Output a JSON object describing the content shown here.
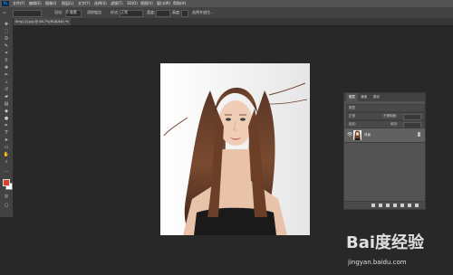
{
  "app": {
    "logo": "Ps",
    "menus": [
      "文件(F)",
      "编辑(E)",
      "图像(I)",
      "图层(L)",
      "文字(Y)",
      "选择(S)",
      "滤镜(T)",
      "3D(D)",
      "视图(V)",
      "窗口(W)",
      "帮助(H)"
    ]
  },
  "options": {
    "feather_label": "羽化:",
    "feather_value": "0 像素",
    "antialias_label": "消除锯齿",
    "style_label": "样式:",
    "style_value": "正常",
    "width_label": "宽度:",
    "height_label": "高度:",
    "refine_label": "选择并遮住..."
  },
  "document": {
    "tab_label": "timg (2).jpg @ 66.7%(RGB/8#) *",
    "close_glyph": "×"
  },
  "tools": [
    "move-tool",
    "marquee-tool",
    "lasso-tool",
    "quick-select-tool",
    "crop-tool",
    "eyedropper-tool",
    "healing-tool",
    "brush-tool",
    "stamp-tool",
    "history-brush-tool",
    "eraser-tool",
    "gradient-tool",
    "blur-tool",
    "dodge-tool",
    "pen-tool",
    "type-tool",
    "path-select-tool",
    "shape-tool",
    "hand-tool",
    "zoom-tool"
  ],
  "colors": {
    "foreground": "#d9402b",
    "background": "#ffffff"
  },
  "layers_panel": {
    "tabs": [
      "图层",
      "通道",
      "路径"
    ],
    "kind_label": "类型",
    "blend_mode": "正常",
    "opacity_label": "不透明度:",
    "lock_label": "锁定:",
    "fill_label": "填充:",
    "layers": [
      {
        "name": "背景",
        "visible": true,
        "locked": true
      }
    ]
  },
  "watermark": {
    "logo": "Bai度经验",
    "url": "jingyan.baidu.com"
  }
}
